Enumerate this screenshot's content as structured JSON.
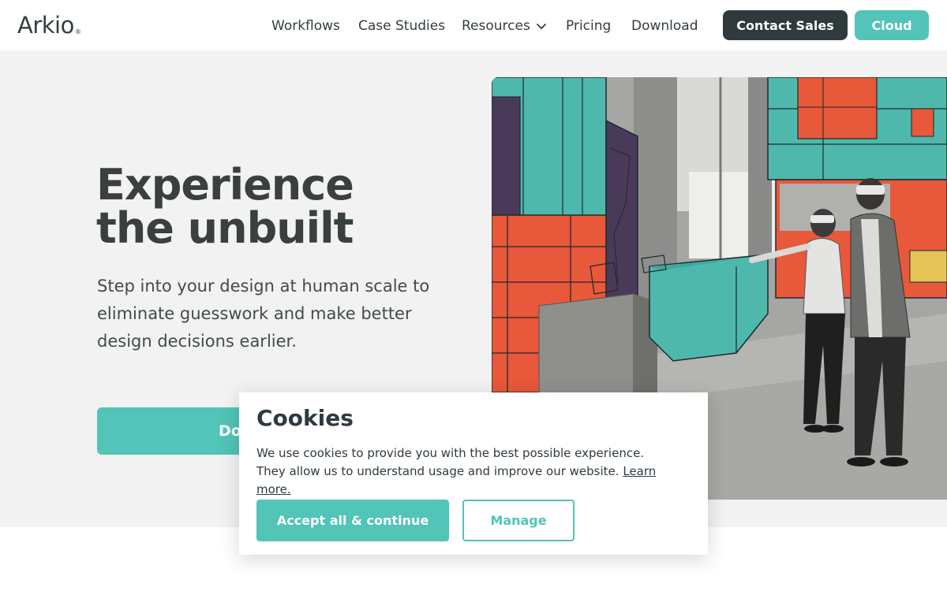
{
  "header": {
    "logo_text": "Arkio",
    "logo_mark": "®",
    "nav": {
      "workflows": "Workflows",
      "case_studies": "Case Studies",
      "resources": "Resources",
      "pricing": "Pricing",
      "download": "Download"
    },
    "contact_sales": "Contact Sales",
    "cloud": "Cloud"
  },
  "hero": {
    "title_line1": "Experience",
    "title_line2": "the unbuilt",
    "subtitle": "Step into your design at human scale to eliminate guesswork and make better design decisions earlier.",
    "cta_visible": "Do",
    "image_icon": "vr-architecture-photo"
  },
  "cookie": {
    "title": "Cookies",
    "text": "We use cookies to provide you with the best possible experience. They allow us to understand usage and improve our website.",
    "link": "Learn more.",
    "accept": "Accept all & continue",
    "manage": "Manage"
  },
  "colors": {
    "accent": "#52c4b8",
    "dark": "#2f3a3c",
    "hero_bg": "#f2f2f2",
    "orange": "#e8583a",
    "purple": "#4a3a5a"
  }
}
